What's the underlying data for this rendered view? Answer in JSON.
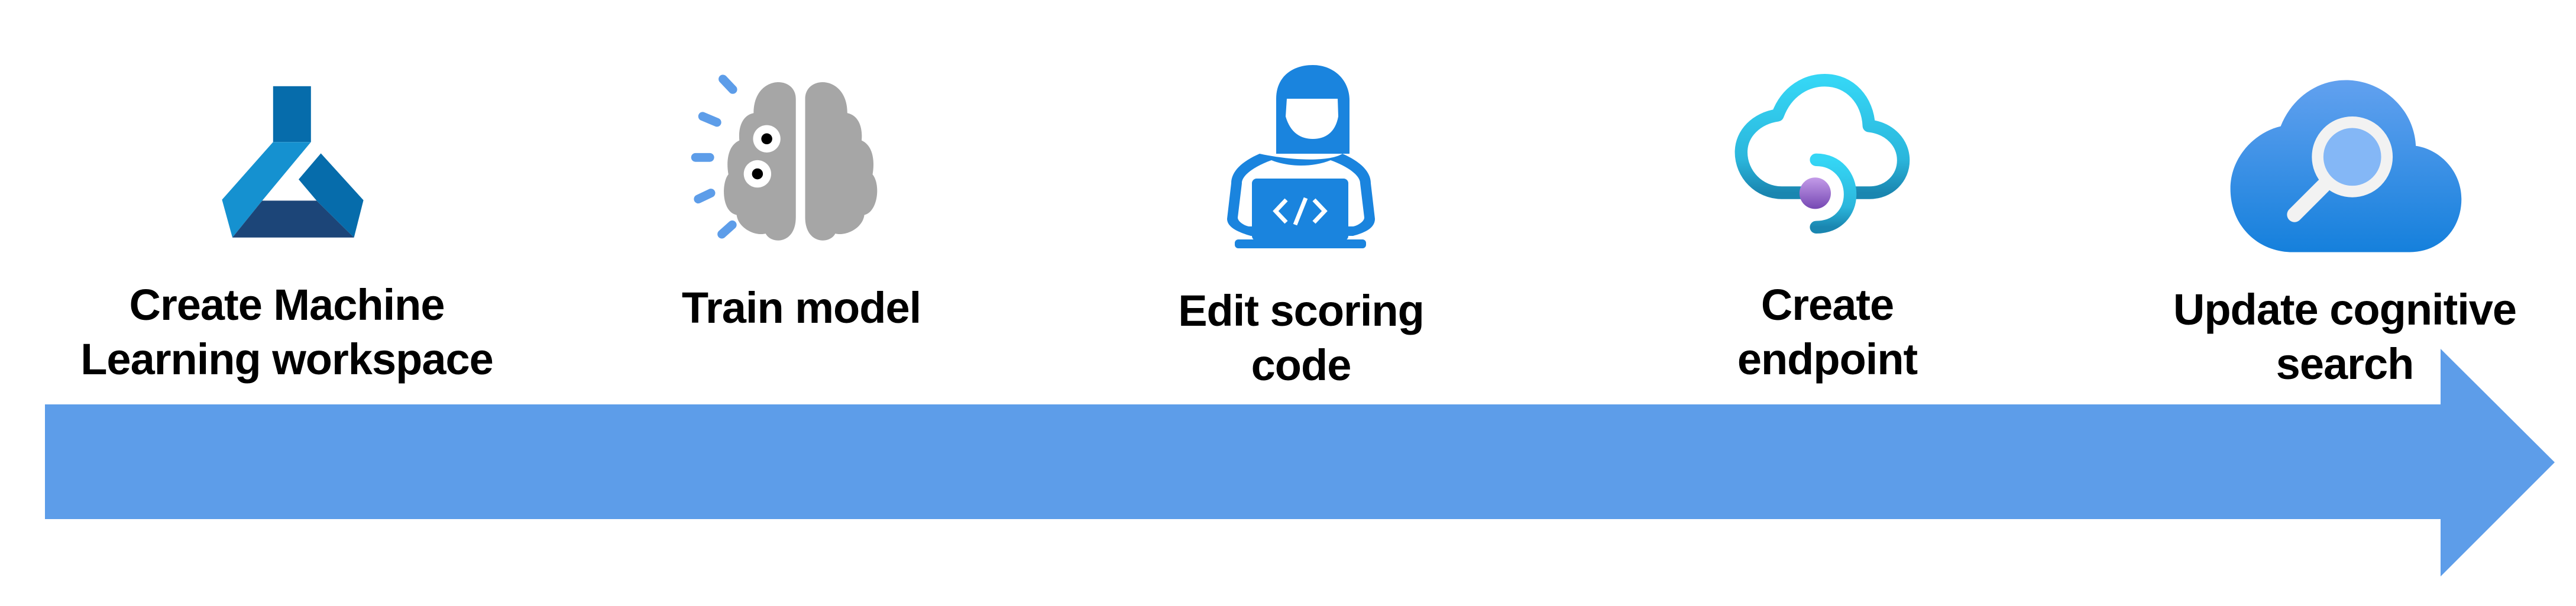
{
  "diagram": {
    "type": "process-flow",
    "arrow_color": "#5d9de9",
    "steps": [
      {
        "icon": "machine-learning-flask-icon",
        "lines": [
          "Create Machine",
          "Learning workspace"
        ]
      },
      {
        "icon": "brain-gears-icon",
        "lines": [
          "Train model"
        ]
      },
      {
        "icon": "developer-laptop-icon",
        "lines": [
          "Edit scoring",
          "code"
        ]
      },
      {
        "icon": "cloud-endpoint-icon",
        "lines": [
          "Create",
          "endpoint"
        ]
      },
      {
        "icon": "cloud-search-icon",
        "lines": [
          "Update cognitive",
          "search"
        ]
      }
    ]
  }
}
